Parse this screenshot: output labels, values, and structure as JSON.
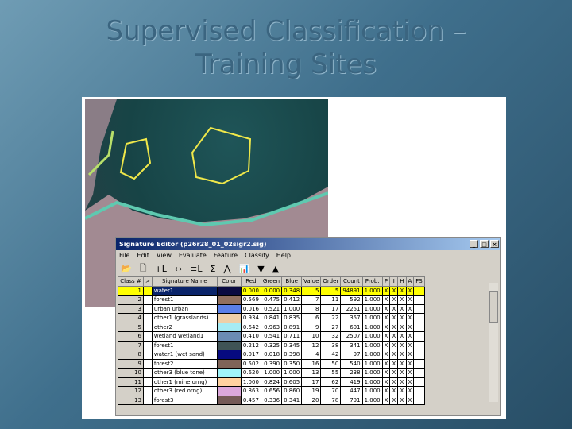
{
  "slide": {
    "title_line1": "Supervised Classification –",
    "title_line2": "Training Sites"
  },
  "window": {
    "title": "Signature Editor (p26r28_01_02sigr2.sig)",
    "controls": [
      "_",
      "□",
      "×"
    ]
  },
  "menu": [
    "File",
    "Edit",
    "View",
    "Evaluate",
    "Feature",
    "Classify",
    "Help"
  ],
  "toolbar": [
    "📂",
    "🗋",
    "+L",
    "↔",
    "≡L",
    "Σ",
    "⋀",
    "📊",
    "▼",
    "▲"
  ],
  "columns": [
    "Class #",
    ">",
    "Signature Name",
    "Color",
    "Red",
    "Green",
    "Blue",
    "Value",
    "Order",
    "Count",
    "Prob.",
    "P",
    "I",
    "H",
    "A",
    "FS"
  ],
  "rows": [
    {
      "n": "1",
      "name": "water1",
      "color": "#0a0a40",
      "r": "0.000",
      "g": "0.000",
      "b": "0.348",
      "v": "5",
      "o": "5",
      "c": "94891",
      "p": "1.000"
    },
    {
      "n": "2",
      "name": "forest1",
      "color": "#91705f",
      "r": "0.569",
      "g": "0.475",
      "b": "0.412",
      "v": "7",
      "o": "11",
      "c": "592",
      "p": "1.000"
    },
    {
      "n": "3",
      "name": "urban urban",
      "color": "#5a7fe8",
      "r": "0.016",
      "g": "0.521",
      "b": "1.000",
      "v": "8",
      "o": "17",
      "c": "2251",
      "p": "1.000"
    },
    {
      "n": "4",
      "name": "other1 (grasslands)",
      "color": "#eecfa8",
      "r": "0.934",
      "g": "0.841",
      "b": "0.835",
      "v": "6",
      "o": "22",
      "c": "357",
      "p": "1.000"
    },
    {
      "n": "5",
      "name": "other2",
      "color": "#a6ecf4",
      "r": "0.642",
      "g": "0.963",
      "b": "0.891",
      "v": "9",
      "o": "27",
      "c": "601",
      "p": "1.000"
    },
    {
      "n": "6",
      "name": "wetland wetland1",
      "color": "#6b8cb3",
      "r": "0.410",
      "g": "0.541",
      "b": "0.711",
      "v": "10",
      "o": "32",
      "c": "2507",
      "p": "1.000"
    },
    {
      "n": "7",
      "name": "forest1",
      "color": "#3f5355",
      "r": "0.212",
      "g": "0.325",
      "b": "0.345",
      "v": "12",
      "o": "38",
      "c": "341",
      "p": "1.000"
    },
    {
      "n": "8",
      "name": "water1 (wet sand)",
      "color": "#060a80",
      "r": "0.017",
      "g": "0.018",
      "b": "0.398",
      "v": "4",
      "o": "42",
      "c": "97",
      "p": "1.000"
    },
    {
      "n": "9",
      "name": "forest2",
      "color": "#7f6458",
      "r": "0.502",
      "g": "0.390",
      "b": "0.350",
      "v": "16",
      "o": "50",
      "c": "540",
      "p": "1.000"
    },
    {
      "n": "10",
      "name": "other3 (blue tone)",
      "color": "#a0f4fa",
      "r": "0.620",
      "g": "1.000",
      "b": "1.000",
      "v": "13",
      "o": "55",
      "c": "238",
      "p": "1.000"
    },
    {
      "n": "11",
      "name": "other1 (mine orng)",
      "color": "#ffd2a0",
      "r": "1.000",
      "g": "0.824",
      "b": "0.605",
      "v": "17",
      "o": "62",
      "c": "419",
      "p": "1.000"
    },
    {
      "n": "12",
      "name": "other3 (red orng)",
      "color": "#dca8dc",
      "r": "0.863",
      "g": "0.656",
      "b": "0.860",
      "v": "19",
      "o": "70",
      "c": "447",
      "p": "1.000"
    },
    {
      "n": "13",
      "name": "forest3",
      "color": "#755a57",
      "r": "0.457",
      "g": "0.336",
      "b": "0.341",
      "v": "20",
      "o": "78",
      "c": "791",
      "p": "1.000"
    }
  ],
  "flag": "X"
}
